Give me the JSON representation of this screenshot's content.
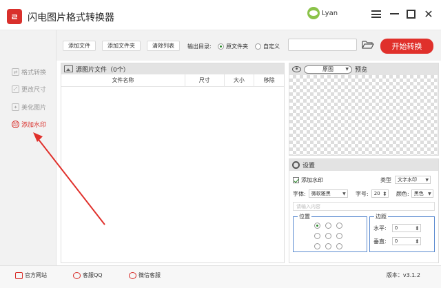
{
  "app": {
    "title": "闪电图片格式转换器",
    "logo_text": "ㄹ"
  },
  "user": {
    "name": "Lyan"
  },
  "sidebar": {
    "items": [
      {
        "label": "格式转换",
        "icon": "convert-icon"
      },
      {
        "label": "更改尺寸",
        "icon": "resize-icon"
      },
      {
        "label": "美化图片",
        "icon": "beautify-icon"
      },
      {
        "label": "添加水印",
        "icon": "watermark-icon",
        "active": true
      }
    ]
  },
  "toolbar": {
    "add_file": "添加文件",
    "add_folder": "添加文件夹",
    "clear_list": "清除列表",
    "output_label": "输出目录:",
    "opt_source": "原文件夹",
    "opt_custom": "自定义",
    "path_value": "",
    "start": "开始转换"
  },
  "source": {
    "title": "源图片文件（0个）",
    "columns": [
      "文件名称",
      "尺寸",
      "大小",
      "移除"
    ]
  },
  "preview": {
    "mode": "原图",
    "label": "预览"
  },
  "settings": {
    "title": "设置",
    "add_watermark": "添加水印",
    "type_label": "类型",
    "type_value": "文字水印",
    "font_label": "字体:",
    "font_value": "微软雅黑",
    "size_label": "字号:",
    "size_value": "20",
    "color_label": "颜色:",
    "color_value": "黑色",
    "content_placeholder": "请输入内容",
    "position_label": "位置",
    "margin_label": "边距",
    "h_label": "水平:",
    "h_value": "0",
    "v_label": "垂直:",
    "v_value": "0"
  },
  "footer": {
    "website": "官方网站",
    "qq": "客服QQ",
    "wechat": "微信客服",
    "version": "版本：v3.1.2"
  },
  "colors": {
    "accent": "#d9302c",
    "start_button": "#e0302b",
    "sidebar_bg": "#f2f2f2"
  }
}
